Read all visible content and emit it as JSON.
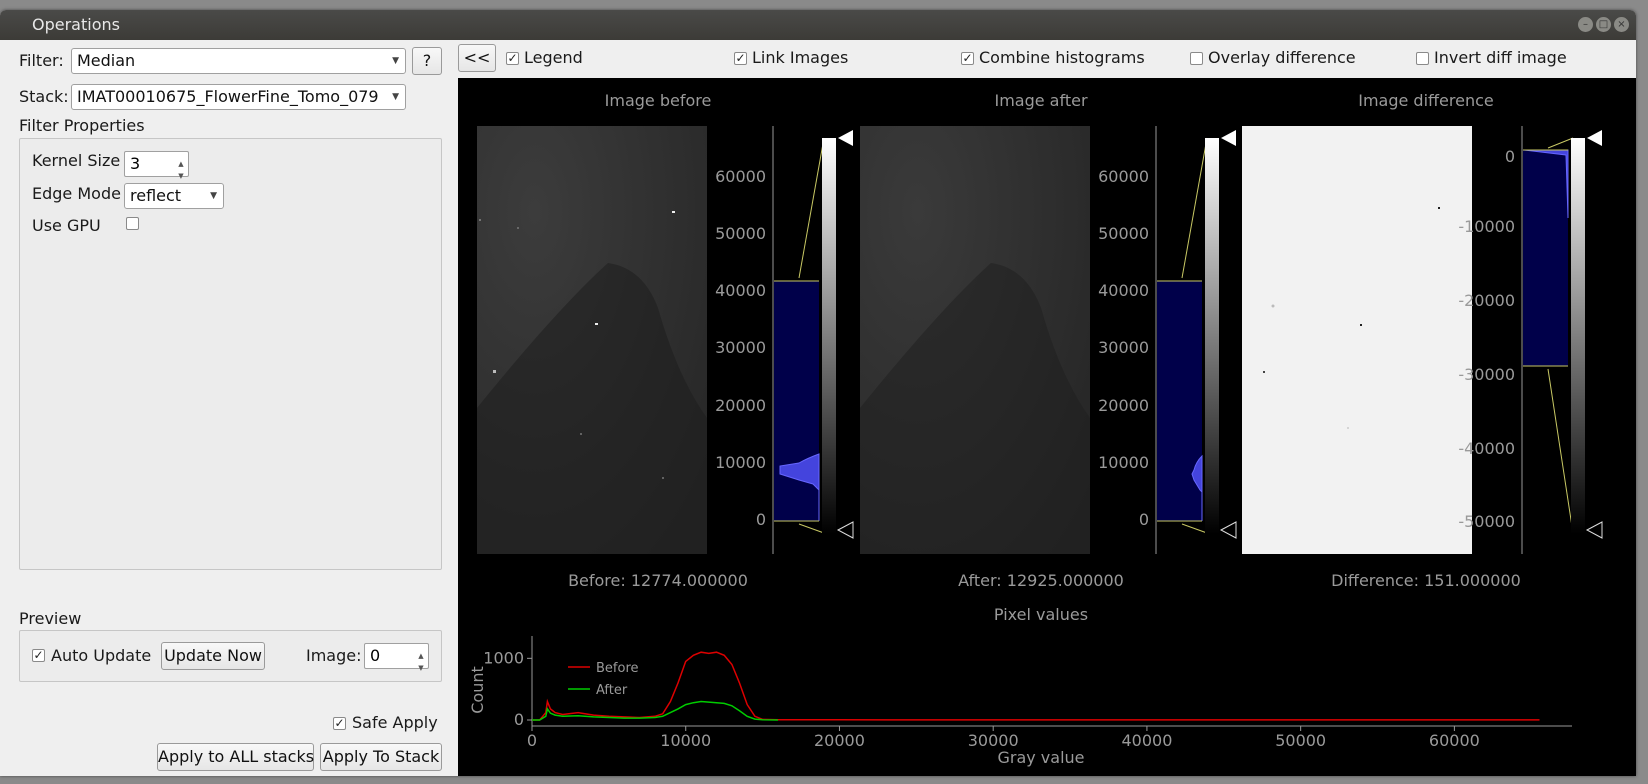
{
  "window": {
    "title": "Operations",
    "controls": [
      "–",
      "□",
      "×"
    ]
  },
  "filter": {
    "label": "Filter:",
    "value": "Median",
    "help": "?"
  },
  "stack": {
    "label": "Stack:",
    "value": "IMAT00010675_FlowerFine_Tomo_079"
  },
  "properties": {
    "heading": "Filter Properties",
    "kernel_size": {
      "label": "Kernel Size",
      "value": "3"
    },
    "edge_mode": {
      "label": "Edge Mode",
      "value": "reflect"
    },
    "use_gpu": {
      "label": "Use GPU",
      "checked": false
    }
  },
  "preview": {
    "heading": "Preview",
    "auto_update": {
      "label": "Auto Update",
      "checked": true
    },
    "update_now": "Update Now",
    "image": {
      "label": "Image:",
      "value": "0"
    }
  },
  "safe_apply": {
    "label": "Safe Apply",
    "checked": true
  },
  "apply_all": "Apply to ALL stacks",
  "apply_stack": "Apply To Stack",
  "toolbar": {
    "collapse": "<<",
    "legend": {
      "label": "Legend",
      "checked": true
    },
    "link_images": {
      "label": "Link Images",
      "checked": true
    },
    "combine_histograms": {
      "label": "Combine histograms",
      "checked": true
    },
    "overlay_difference": {
      "label": "Overlay difference",
      "checked": false
    },
    "invert_diff": {
      "label": "Invert diff image",
      "checked": false
    }
  },
  "panels": {
    "before": {
      "title": "Image before",
      "readout": "Before: 12774.000000",
      "ticks": [
        "60000",
        "50000",
        "40000",
        "30000",
        "20000",
        "10000",
        "0"
      ]
    },
    "after": {
      "title": "Image after",
      "readout": "After: 12925.000000",
      "ticks": [
        "60000",
        "50000",
        "40000",
        "30000",
        "20000",
        "10000",
        "0"
      ]
    },
    "difference": {
      "title": "Image difference",
      "readout": "Difference: 151.000000",
      "ticks": [
        "0",
        "-10000",
        "-20000",
        "-30000",
        "-40000",
        "-50000"
      ]
    }
  },
  "colors": {
    "histogram_fill": "#00004a",
    "histogram_line": "#5555ff",
    "region_line": "#c8c864",
    "before_series": "#dd0000",
    "after_series": "#00cc00"
  },
  "chart_data": {
    "type": "line",
    "title": "Pixel values",
    "xlabel": "Gray value",
    "ylabel": "Count",
    "xlim": [
      0,
      67000
    ],
    "ylim": [
      0,
      1200
    ],
    "xticks": [
      "0",
      "10000",
      "20000",
      "30000",
      "40000",
      "50000",
      "60000"
    ],
    "yticks": [
      "0",
      "1000"
    ],
    "legend": "top-left",
    "series": [
      {
        "name": "Before",
        "x": [
          0,
          500,
          900,
          1000,
          1200,
          1500,
          2000,
          3000,
          4000,
          5000,
          6000,
          7000,
          8000,
          8500,
          9000,
          9500,
          10000,
          10500,
          11000,
          11500,
          12000,
          12500,
          13000,
          13500,
          14000,
          14500,
          15000,
          16000,
          20000,
          30000,
          40000,
          50000,
          60000,
          65535
        ],
        "values": [
          0,
          0,
          120,
          300,
          180,
          120,
          90,
          120,
          80,
          60,
          50,
          40,
          60,
          100,
          300,
          600,
          950,
          1050,
          1100,
          1080,
          1100,
          1050,
          900,
          600,
          250,
          60,
          10,
          5,
          3,
          2,
          2,
          2,
          2,
          2
        ]
      },
      {
        "name": "After",
        "x": [
          0,
          500,
          900,
          1000,
          1200,
          1500,
          2000,
          3000,
          4000,
          5000,
          6000,
          7000,
          8000,
          8500,
          9000,
          9500,
          10000,
          10500,
          11000,
          11500,
          12000,
          12500,
          13000,
          13500,
          14000,
          14500,
          15000,
          16000
        ],
        "values": [
          0,
          0,
          60,
          180,
          110,
          80,
          60,
          70,
          50,
          40,
          30,
          30,
          40,
          60,
          120,
          180,
          250,
          280,
          300,
          290,
          280,
          270,
          230,
          150,
          60,
          15,
          3,
          0
        ]
      }
    ]
  }
}
